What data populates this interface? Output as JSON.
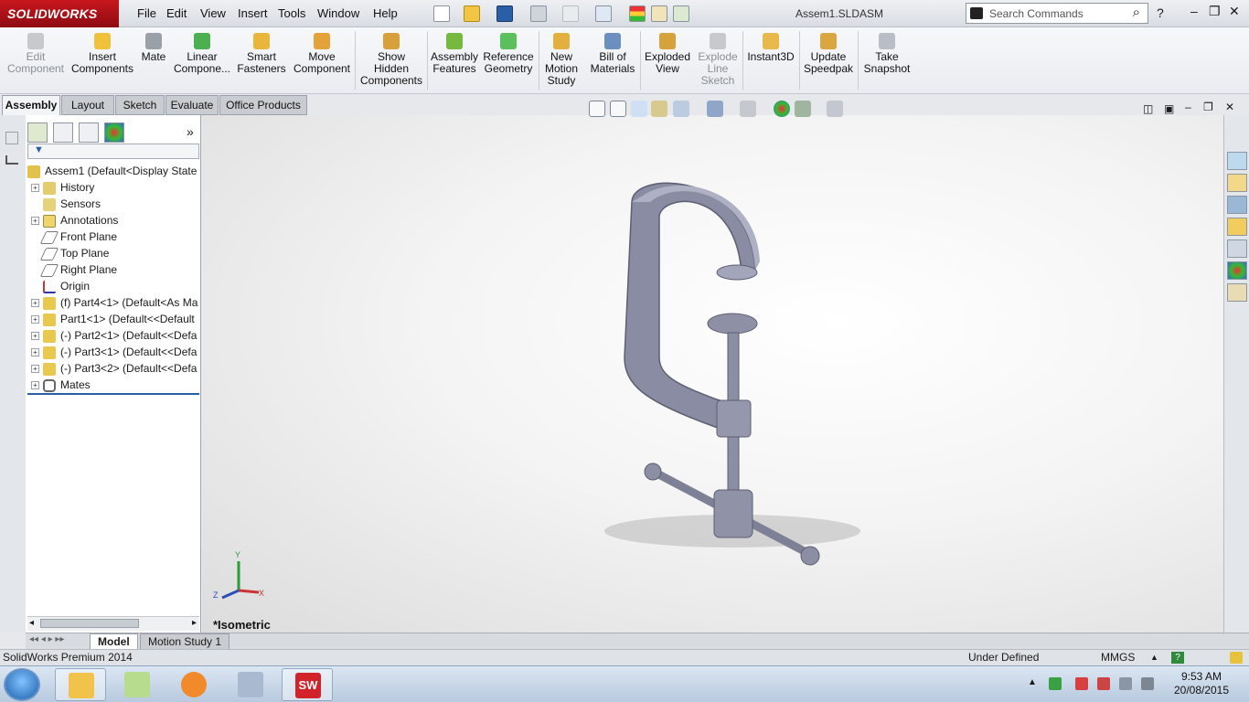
{
  "app": {
    "logo": "SOLIDWORKS",
    "doc_title": "Assem1.SLDASM"
  },
  "menu": [
    "File",
    "Edit",
    "View",
    "Insert",
    "Tools",
    "Window",
    "Help"
  ],
  "search": {
    "placeholder": "Search Commands"
  },
  "ribbon": [
    {
      "label": "Edit\nComponent",
      "icon": "edit-component-icon",
      "disabled": true
    },
    {
      "label": "Insert\nComponents",
      "icon": "insert-components-icon",
      "disabled": false
    },
    {
      "label": "Mate",
      "icon": "mate-icon",
      "disabled": false
    },
    {
      "label": "Linear\nCompone...",
      "icon": "linear-pattern-icon",
      "disabled": false
    },
    {
      "label": "Smart\nFasteners",
      "icon": "smart-fasteners-icon",
      "disabled": false
    },
    {
      "label": "Move\nComponent",
      "icon": "move-component-icon",
      "disabled": false
    },
    {
      "label": "Show\nHidden\nComponents",
      "icon": "show-hidden-icon",
      "disabled": false
    },
    {
      "label": "Assembly\nFeatures",
      "icon": "assembly-features-icon",
      "disabled": false
    },
    {
      "label": "Reference\nGeometry",
      "icon": "reference-geometry-icon",
      "disabled": false
    },
    {
      "label": "New\nMotion\nStudy",
      "icon": "motion-study-icon",
      "disabled": false
    },
    {
      "label": "Bill of\nMaterials",
      "icon": "bom-icon",
      "disabled": false
    },
    {
      "label": "Exploded\nView",
      "icon": "exploded-view-icon",
      "disabled": false
    },
    {
      "label": "Explode\nLine\nSketch",
      "icon": "explode-line-icon",
      "disabled": true
    },
    {
      "label": "Instant3D",
      "icon": "instant3d-icon",
      "disabled": false
    },
    {
      "label": "Update\nSpeedpak",
      "icon": "speedpak-icon",
      "disabled": false
    },
    {
      "label": "Take\nSnapshot",
      "icon": "snapshot-icon",
      "disabled": false
    }
  ],
  "tabs": [
    "Assembly",
    "Layout",
    "Sketch",
    "Evaluate",
    "Office Products"
  ],
  "tree": [
    {
      "label": "Assem1  (Default<Display State-",
      "icon": "assembly-icon",
      "expander": false
    },
    {
      "label": "History",
      "icon": "history-icon",
      "expander": true
    },
    {
      "label": "Sensors",
      "icon": "sensors-icon",
      "expander": false
    },
    {
      "label": "Annotations",
      "icon": "annotations-icon",
      "expander": true
    },
    {
      "label": "Front Plane",
      "icon": "plane-icon",
      "expander": false
    },
    {
      "label": "Top Plane",
      "icon": "plane-icon",
      "expander": false
    },
    {
      "label": "Right Plane",
      "icon": "plane-icon",
      "expander": false
    },
    {
      "label": "Origin",
      "icon": "origin-icon",
      "expander": false
    },
    {
      "label": "(f) Part4<1> (Default<As Ma",
      "icon": "part-icon",
      "expander": true
    },
    {
      "label": "Part1<1> (Default<<Default",
      "icon": "part-icon",
      "expander": true
    },
    {
      "label": "(-) Part2<1> (Default<<Defa",
      "icon": "part-icon",
      "expander": true
    },
    {
      "label": "(-) Part3<1> (Default<<Defa",
      "icon": "part-icon",
      "expander": true
    },
    {
      "label": "(-) Part3<2> (Default<<Defa",
      "icon": "part-icon",
      "expander": true
    },
    {
      "label": "Mates",
      "icon": "mates-icon",
      "expander": true
    }
  ],
  "view": {
    "orientation_label": "*Isometric"
  },
  "bottom_tabs": [
    "Model",
    "Motion Study 1"
  ],
  "status": {
    "product": "SolidWorks Premium 2014",
    "state": "Under Defined",
    "units": "MMGS"
  },
  "clock": {
    "time": "9:53 AM",
    "date": "20/08/2015"
  }
}
